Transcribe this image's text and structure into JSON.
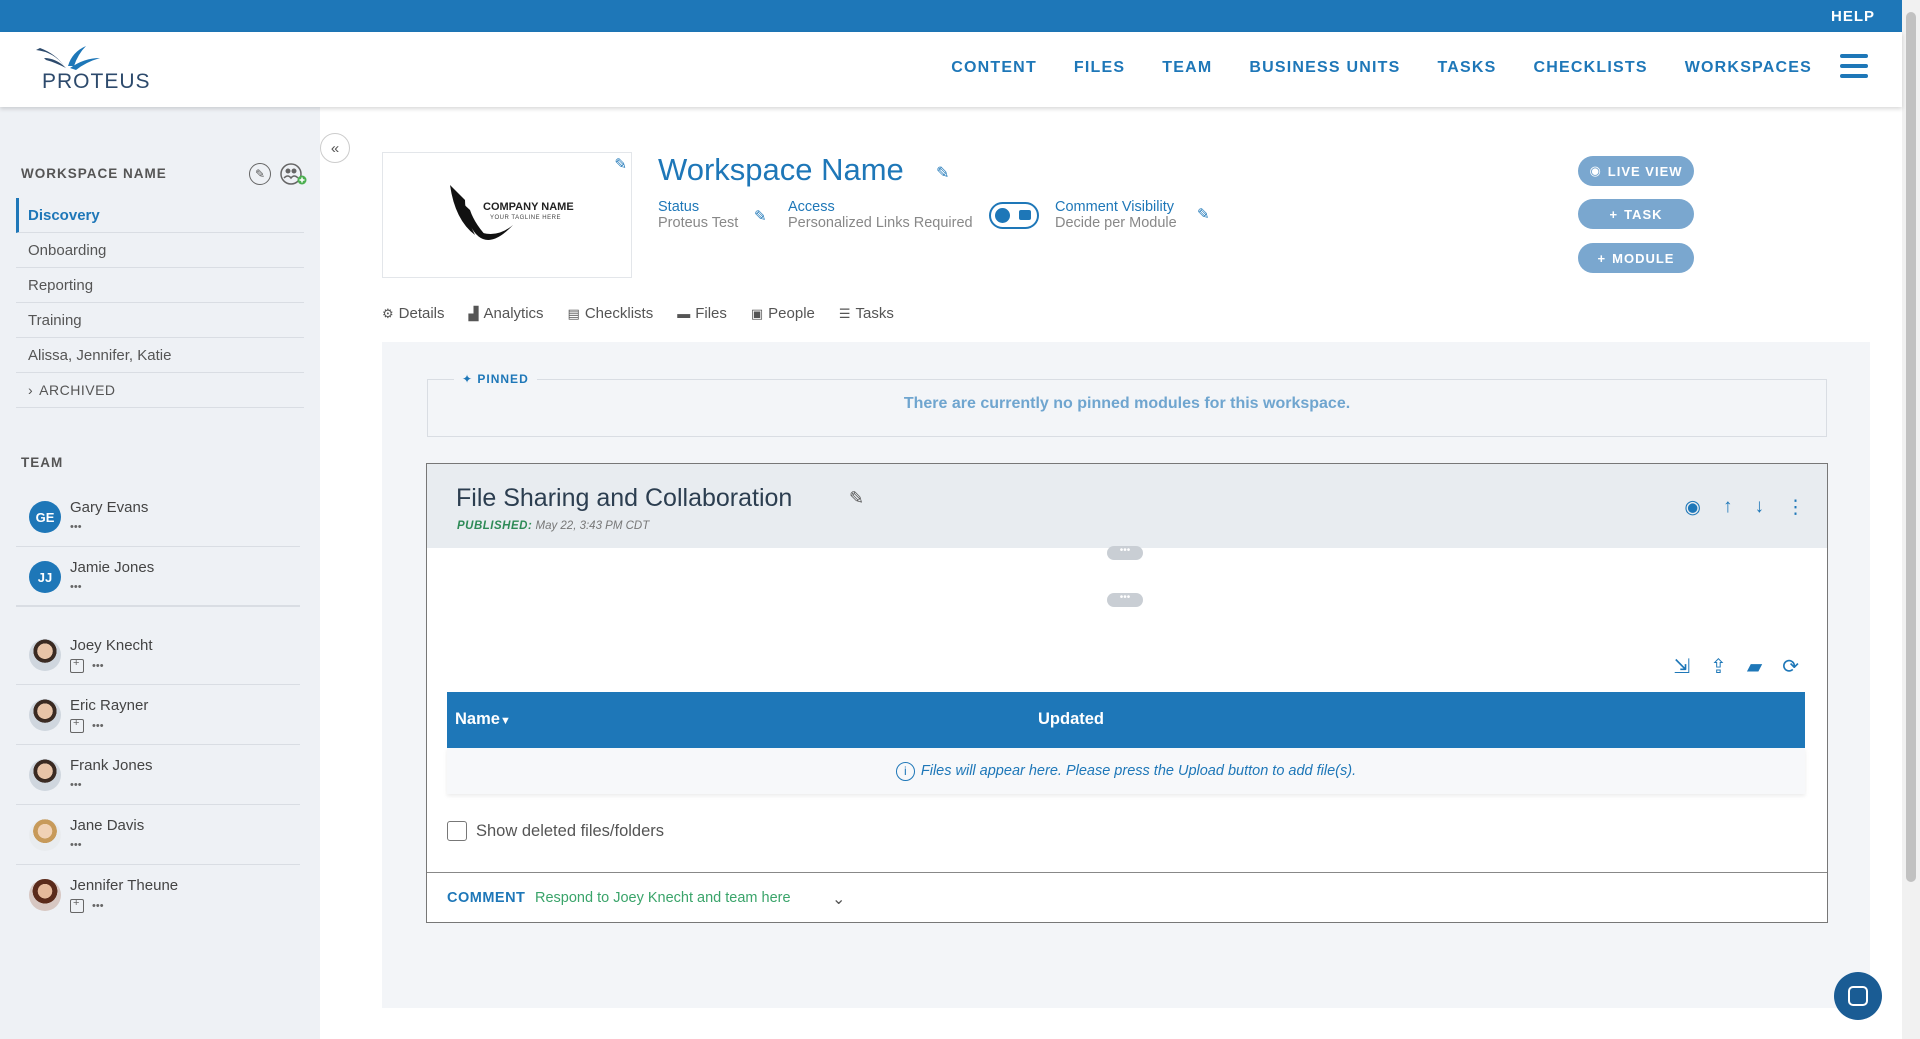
{
  "topbar": {
    "help": "HELP"
  },
  "brand": {
    "name": "PROTEUS"
  },
  "nav": [
    "CONTENT",
    "FILES",
    "TEAM",
    "BUSINESS UNITS",
    "TASKS",
    "CHECKLISTS",
    "WORKSPACES"
  ],
  "sidebar": {
    "workspace_title": "WORKSPACE NAME",
    "items": [
      {
        "label": "Discovery",
        "active": true
      },
      {
        "label": "Onboarding"
      },
      {
        "label": "Reporting"
      },
      {
        "label": "Training"
      },
      {
        "label": "Alissa, Jennifer, Katie"
      }
    ],
    "archived": "ARCHIVED",
    "team_title": "TEAM",
    "team": [
      {
        "name": "Gary Evans",
        "initials": "GE"
      },
      {
        "name": "Jamie Jones",
        "initials": "JJ"
      },
      {
        "name": "Joey Knecht"
      },
      {
        "name": "Eric Rayner"
      },
      {
        "name": "Frank Jones"
      },
      {
        "name": "Jane Davis"
      },
      {
        "name": "Jennifer Theune"
      }
    ]
  },
  "workspace": {
    "logo_company": "COMPANY NAME",
    "logo_tagline": "YOUR TAGLINE HERE",
    "title": "Workspace Name",
    "status_label": "Status",
    "status_value": "Proteus Test",
    "access_label": "Access",
    "access_value": "Personalized Links Required",
    "comment_vis_label": "Comment Visibility",
    "comment_vis_value": "Decide per Module"
  },
  "actions": {
    "live_view": "LIVE VIEW",
    "task": "TASK",
    "module": "MODULE"
  },
  "tabs": [
    {
      "label": "Details",
      "icon": "gears-icon"
    },
    {
      "label": "Analytics",
      "icon": "analytics-icon"
    },
    {
      "label": "Checklists",
      "icon": "clipboard-icon"
    },
    {
      "label": "Files",
      "icon": "folder-icon"
    },
    {
      "label": "People",
      "icon": "id-card-icon"
    },
    {
      "label": "Tasks",
      "icon": "list-icon"
    }
  ],
  "pinned": {
    "label": "PINNED",
    "message": "There are currently no pinned modules for this workspace."
  },
  "module": {
    "title": "File Sharing and Collaboration",
    "published_label": "PUBLISHED:",
    "published_date": "May 22, 3:43 PM CDT",
    "table": {
      "col_name": "Name",
      "col_updated": "Updated",
      "empty": "Files will appear here. Please press the Upload button to add file(s)."
    },
    "show_deleted": "Show deleted files/folders",
    "comment_label": "COMMENT",
    "comment_text": "Respond to Joey Knecht and team here"
  },
  "colors": {
    "primary": "#1e77b8",
    "pill": "#7aa7cf",
    "sidebar_bg": "#eef1f5",
    "published": "#2e8b57"
  }
}
